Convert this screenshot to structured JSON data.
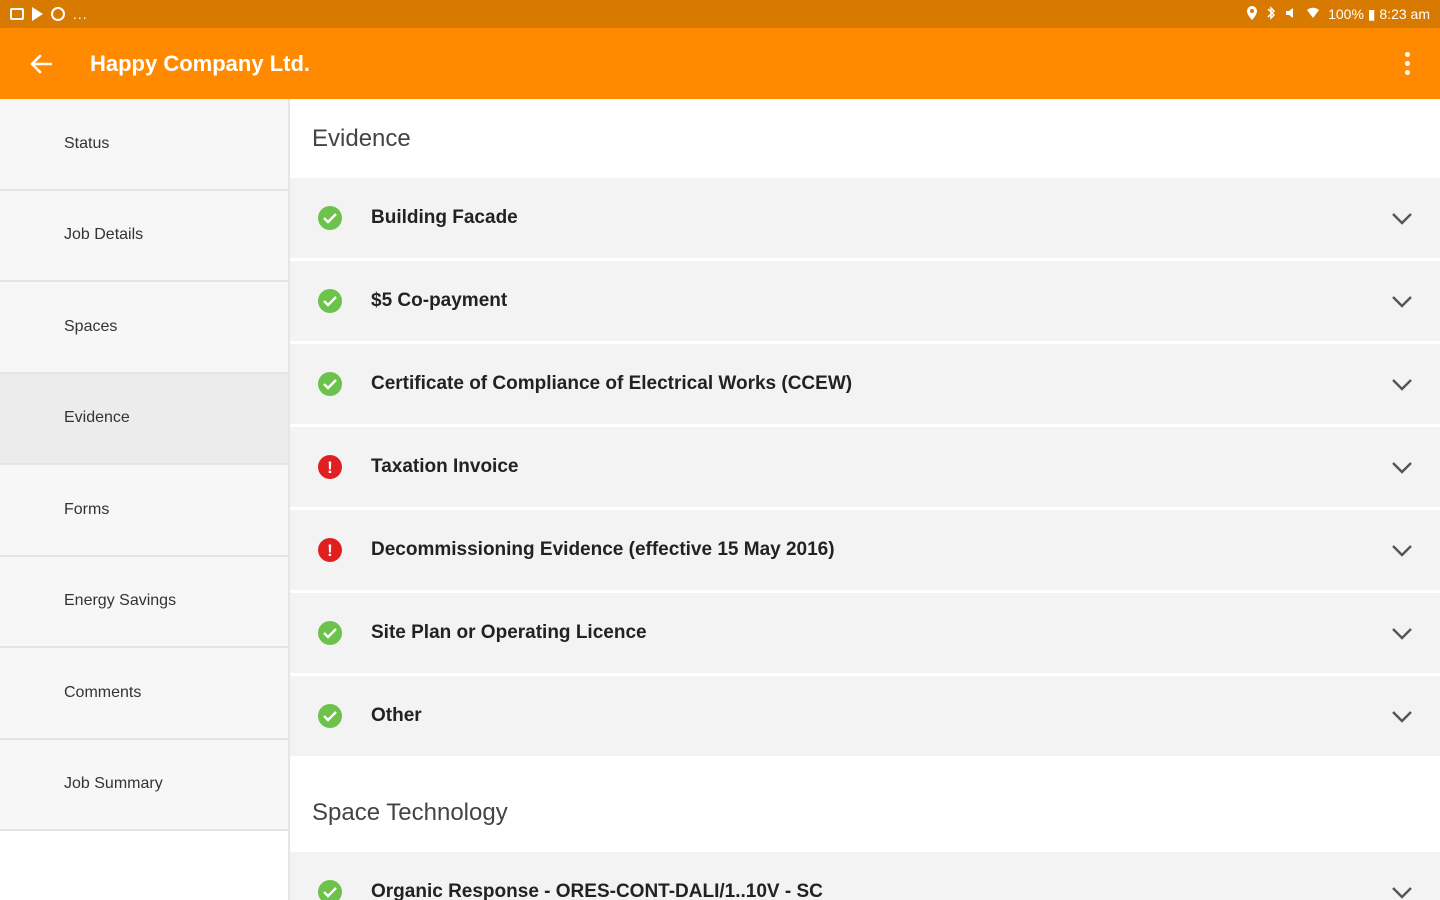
{
  "status_bar": {
    "left_more": "...",
    "right_text": "100% ▮ 8:23 am"
  },
  "app_bar": {
    "title": "Happy Company Ltd."
  },
  "sidebar": {
    "items": [
      {
        "label": "Status"
      },
      {
        "label": "Job Details"
      },
      {
        "label": "Spaces"
      },
      {
        "label": "Evidence"
      },
      {
        "label": "Forms"
      },
      {
        "label": "Energy Savings"
      },
      {
        "label": "Comments"
      },
      {
        "label": "Job Summary"
      }
    ],
    "active": "Evidence"
  },
  "main": {
    "evidence_title": "Evidence",
    "evidence_items": [
      {
        "label": "Building Facade",
        "status": "complete"
      },
      {
        "label": "$5 Co-payment",
        "status": "complete"
      },
      {
        "label": "Certificate of Compliance of Electrical Works (CCEW)",
        "status": "complete"
      },
      {
        "label": "Taxation Invoice",
        "status": "missing"
      },
      {
        "label": "Decommissioning Evidence (effective 15 May 2016)",
        "status": "missing"
      },
      {
        "label": "Site Plan or Operating Licence",
        "status": "complete"
      },
      {
        "label": "Other",
        "status": "complete"
      }
    ],
    "space_title": "Space Technology",
    "space_items": [
      {
        "label": "Organic Response - ORES-CONT-DALI/1..10V - SC",
        "status": "complete"
      }
    ]
  },
  "colors": {
    "status_bar": "#d97a00",
    "app_bar": "#ff8a00",
    "ok": "#6cc24a",
    "error": "#e02020"
  }
}
